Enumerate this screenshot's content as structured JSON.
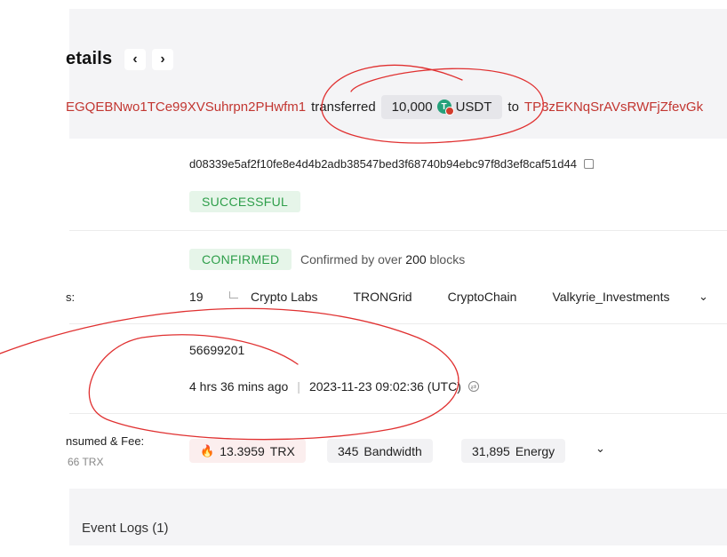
{
  "header": {
    "title": "etails",
    "prev_label": "‹",
    "next_label": "›"
  },
  "transfer": {
    "from_address": "EGQEBNwo1TCe99XVSuhrpn2PHwfm1",
    "verb": "transferred",
    "amount": "10,000",
    "token": "USDT",
    "to_word": "to",
    "to_address": "TP3zEKNqSrAVsRWFjZfevGk"
  },
  "hash": {
    "value": "d08339e5af2f10fe8e4d4b2adb38547bed3f68740b94ebc97f8d3ef8caf51d44"
  },
  "result": {
    "status": "SUCCESSFUL"
  },
  "confirmation": {
    "status": "CONFIRMED",
    "text_prefix": "Confirmed by over",
    "blocks_count": "200",
    "text_suffix": "blocks"
  },
  "super_representatives": {
    "label": "s:",
    "count": "19",
    "items": [
      "Crypto Labs",
      "TRONGrid",
      "CryptoChain",
      "Valkyrie_Investments"
    ]
  },
  "block": {
    "number": "56699201",
    "relative_time": "4 hrs 36 mins ago",
    "separator": "|",
    "timestamp": "2023-11-23 09:02:36 (UTC)"
  },
  "resources": {
    "label": "nsumed & Fee:",
    "sublabel": "66 TRX",
    "trx_value": "13.3959",
    "trx_unit": "TRX",
    "bandwidth_value": "345",
    "bandwidth_unit": "Bandwidth",
    "energy_value": "31,895",
    "energy_unit": "Energy"
  },
  "events": {
    "label": "Event Logs (1)"
  },
  "icons": {
    "token": "usdt-token-icon",
    "copy": "copy-icon",
    "timezone": "timezone-switch-icon",
    "burn": "fire-icon",
    "expand": "chevron-down-icon"
  },
  "colors": {
    "address_red": "#c23631",
    "success_green": "#2e9e4a",
    "annotation_red": "#e03030"
  }
}
